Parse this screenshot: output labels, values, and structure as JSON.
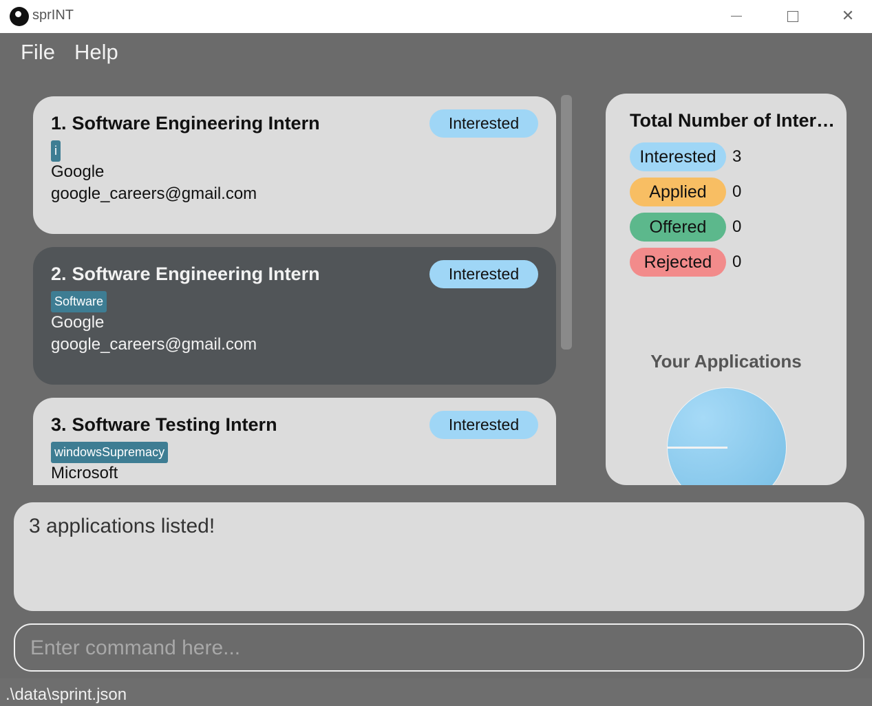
{
  "window": {
    "title": "sprINT",
    "min_label": "–",
    "close_label": "✕"
  },
  "menu": {
    "file": "File",
    "help": "Help"
  },
  "applications": [
    {
      "index": "1.",
      "role": "Software Engineering Intern",
      "status": "Interested",
      "tag": "i",
      "company": "Google",
      "email": "google_careers@gmail.com"
    },
    {
      "index": "2.",
      "role": "Software Engineering Intern",
      "status": "Interested",
      "tag": "Software",
      "company": "Google",
      "email": "google_careers@gmail.com"
    },
    {
      "index": "3.",
      "role": "Software Testing Intern",
      "status": "Interested",
      "tag": "windowsSupremacy",
      "company": "Microsoft",
      "email": ""
    }
  ],
  "stats": {
    "title": "Total Number of Internships",
    "rows": [
      {
        "label": "Interested",
        "count": "3",
        "color": "#9fd6f6"
      },
      {
        "label": "Applied",
        "count": "0",
        "color": "#f8be63"
      },
      {
        "label": "Offered",
        "count": "0",
        "color": "#5cb88c"
      },
      {
        "label": "Rejected",
        "count": "0",
        "color": "#f28b8b"
      }
    ],
    "chart_title": "Your Applications"
  },
  "chart_data": {
    "type": "pie",
    "title": "Your Applications",
    "categories": [
      "Interested",
      "Applied",
      "Offered",
      "Rejected"
    ],
    "values": [
      3,
      0,
      0,
      0
    ]
  },
  "result": {
    "message": "3 applications listed!"
  },
  "command": {
    "placeholder": "Enter command here..."
  },
  "status_bar": {
    "path": ".\\data\\sprint.json"
  },
  "colors": {
    "selected_card": "#515558",
    "card": "#dcdcdc",
    "tag": "#3e7d93",
    "background": "#6b6b6b"
  }
}
